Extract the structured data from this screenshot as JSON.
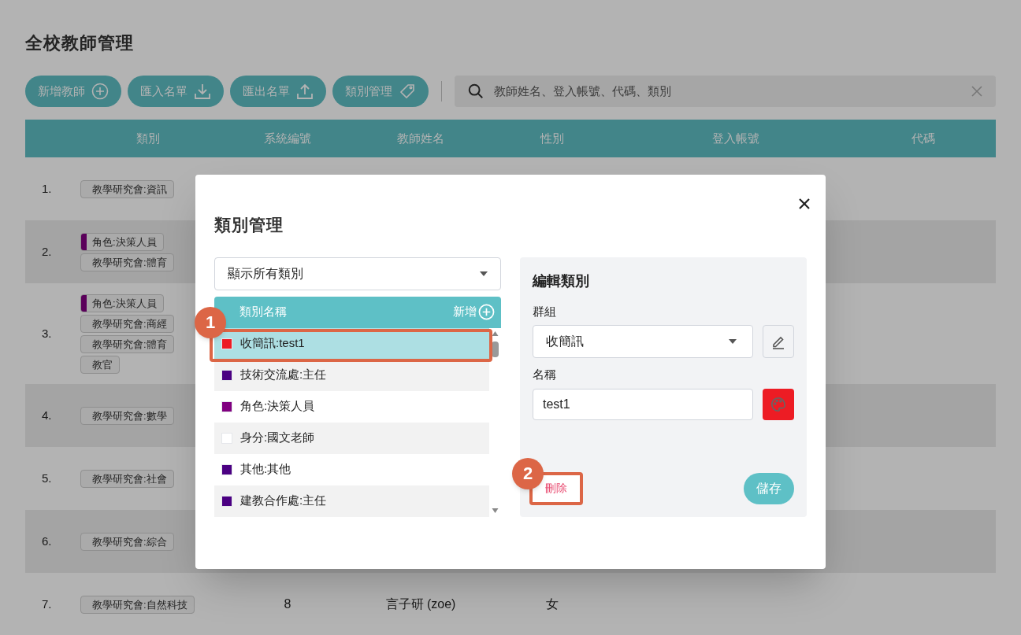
{
  "page": {
    "title": "全校教師管理"
  },
  "toolbar": {
    "buttons": [
      {
        "label": "新增教師"
      },
      {
        "label": "匯入名單"
      },
      {
        "label": "匯出名單"
      },
      {
        "label": "類別管理"
      }
    ]
  },
  "search": {
    "placeholder": "教師姓名、登入帳號、代碼、類別"
  },
  "table": {
    "columns": [
      "類別",
      "系統編號",
      "教師姓名",
      "性別",
      "登入帳號",
      "代碼"
    ],
    "rows": [
      {
        "number": "1.",
        "tags": [
          {
            "label": "教學研究會:資訊"
          }
        ]
      },
      {
        "number": "2.",
        "tags": [
          {
            "label": "角色:決策人員",
            "color": "#5a005a"
          },
          {
            "label": "教學研究會:體育"
          }
        ]
      },
      {
        "number": "3.",
        "tags": [
          {
            "label": "角色:決策人員",
            "color": "#5a005a"
          },
          {
            "label": "教學研究會:商經"
          },
          {
            "label": "教學研究會:體育"
          },
          {
            "label": "教官"
          }
        ]
      },
      {
        "number": "4.",
        "tags": [
          {
            "label": "教學研究會:數學"
          }
        ]
      },
      {
        "number": "5.",
        "tags": [
          {
            "label": "教學研究會:社會"
          }
        ]
      },
      {
        "number": "6.",
        "tags": [
          {
            "label": "教學研究會:綜合"
          }
        ]
      },
      {
        "number": "7.",
        "tags": [
          {
            "label": "教學研究會:自然科技"
          }
        ],
        "system_id": "8",
        "name": "言子研 (zoe)",
        "gender": "女"
      }
    ]
  },
  "dialog": {
    "title": "類別管理",
    "filter": {
      "value": "顯示所有類別"
    },
    "list": {
      "header": "類別名稱",
      "add_label": "新增",
      "items": [
        {
          "label": "收簡訊:test1",
          "color": "#ed1c24",
          "selected": true,
          "annotation": "1"
        },
        {
          "label": "技術交流處:主任",
          "color": "#4b0082",
          "selected": false
        },
        {
          "label": "角色:決策人員",
          "color": "#800080",
          "selected": false
        },
        {
          "label": "身分:國文老師",
          "color": "#ffffff",
          "selected": false
        },
        {
          "label": "其他:其他",
          "color": "#4b0082",
          "selected": false
        },
        {
          "label": "建教合作處:主任",
          "color": "#4b0082",
          "selected": false
        }
      ]
    },
    "editor": {
      "title": "編輯類別",
      "group_label": "群組",
      "group_value": "收簡訊",
      "name_label": "名稱",
      "name_value": "test1",
      "color": "#ed1c24",
      "delete_label": "刪除",
      "delete_annotation": "2",
      "save_label": "儲存"
    }
  }
}
